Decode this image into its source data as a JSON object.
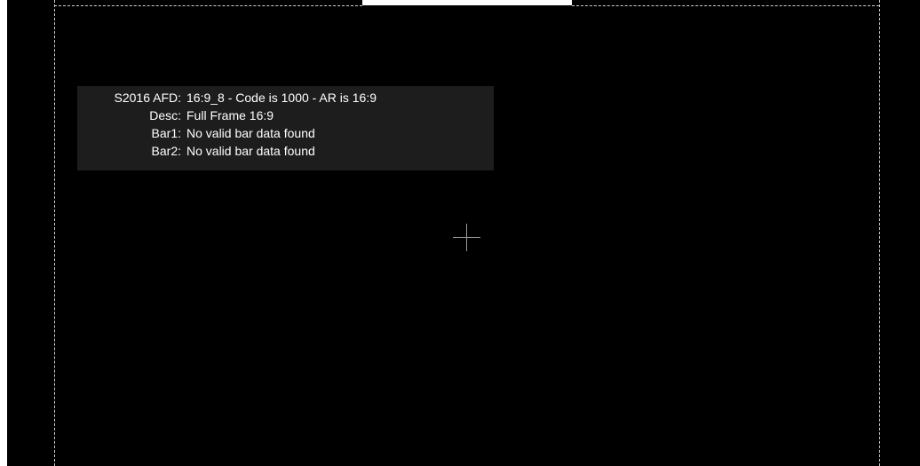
{
  "afd_overlay": {
    "rows": [
      {
        "label": "S2016 AFD:",
        "value": "16:9_8 - Code is 1000 - AR is 16:9"
      },
      {
        "label": "Desc:",
        "value": "Full Frame 16:9"
      },
      {
        "label": "Bar1:",
        "value": "No valid bar data found"
      },
      {
        "label": "Bar2:",
        "value": "No valid bar data found"
      }
    ]
  },
  "colors": {
    "background": "#000000",
    "panel": "#1d1d1d",
    "text": "#ffffff",
    "guide": "#cfcfcf",
    "crosshair": "#9a9a9a"
  },
  "icons": {
    "center_marker": "crosshair-icon"
  }
}
